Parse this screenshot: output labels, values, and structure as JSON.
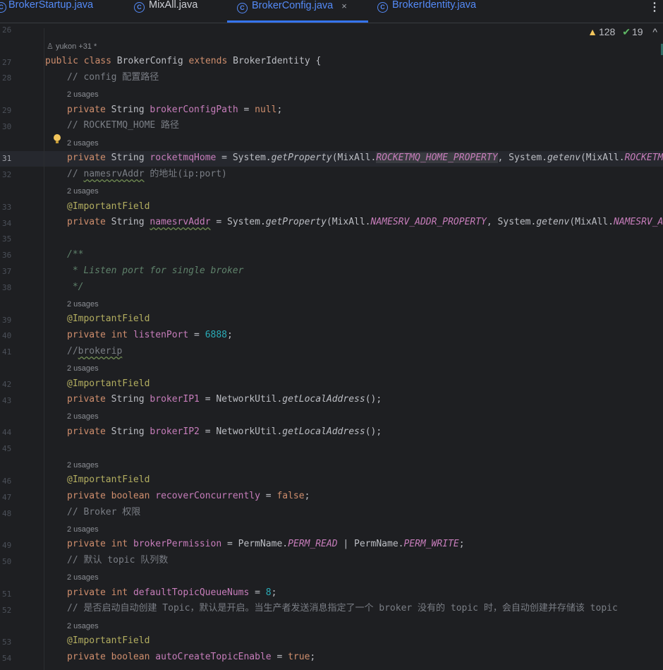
{
  "tabs": [
    {
      "label": "BrokerStartup.java"
    },
    {
      "label": "MixAll.java"
    },
    {
      "label": "BrokerConfig.java"
    },
    {
      "label": "BrokerIdentity.java"
    }
  ],
  "tab_close_glyph": "×",
  "more_glyph": "⋮",
  "inspections": {
    "warnings": "128",
    "weak_warnings": "19"
  },
  "author_hint": "yukon +31 *",
  "line_numbers": [
    "26",
    "27",
    "28",
    "29",
    "30",
    "31",
    "32",
    "33",
    "34",
    "35",
    "36",
    "37",
    "38",
    "39",
    "40",
    "41",
    "42",
    "43",
    "44",
    "45",
    "46",
    "47",
    "48",
    "49",
    "50",
    "51",
    "52",
    "53",
    "54"
  ],
  "usages_hint": "2 usages",
  "code": {
    "l27": [
      "public class ",
      "BrokerConfig ",
      "extends ",
      "BrokerIdentity {"
    ],
    "l28": "// config 配置路径",
    "l29": [
      "private ",
      "String ",
      "brokerConfigPath",
      " = ",
      "null",
      ";"
    ],
    "l30": "// ROCKETMQ_HOME 路径",
    "l31": [
      "private ",
      "String ",
      "rocketmqHome",
      " = System.",
      "getProperty",
      "(MixAll.",
      "ROCKETMQ_HOME_PROPERTY",
      ", System.",
      "getenv",
      "(MixAll.",
      "ROCKETMQ_H"
    ],
    "l32": [
      "// ",
      "namesrvAddr",
      " 的地址(ip:port)"
    ],
    "l33": "@ImportantField",
    "l34": [
      "private ",
      "String ",
      "namesrvAddr",
      " = System.",
      "getProperty",
      "(MixAll.",
      "NAMESRV_ADDR_PROPERTY",
      ", System.",
      "getenv",
      "(MixAll.",
      "NAMESRV_ADDR"
    ],
    "l36": "/**",
    "l37": " * Listen port for single broker",
    "l38": " */",
    "l39": "@ImportantField",
    "l40": [
      "private ",
      "int ",
      "listenPort",
      " = ",
      "6888",
      ";"
    ],
    "l41": [
      "//",
      "brokerip"
    ],
    "l42": "@ImportantField",
    "l43": [
      "private ",
      "String ",
      "brokerIP1",
      " = NetworkUtil.",
      "getLocalAddress",
      "();"
    ],
    "l44": [
      "private ",
      "String ",
      "brokerIP2",
      " = NetworkUtil.",
      "getLocalAddress",
      "();"
    ],
    "l46": "@ImportantField",
    "l47": [
      "private ",
      "boolean ",
      "recoverConcurrently",
      " = ",
      "false",
      ";"
    ],
    "l48": "// Broker 权限",
    "l49": [
      "private ",
      "int ",
      "brokerPermission",
      " = PermName.",
      "PERM_READ",
      " | PermName.",
      "PERM_WRITE",
      ";"
    ],
    "l50": "// 默认 topic 队列数",
    "l51": [
      "private ",
      "int ",
      "defaultTopicQueueNums",
      " = ",
      "8",
      ";"
    ],
    "l52": "// 是否启动自动创建 Topic，默认是开启。当生产者发送消息指定了一个 broker 没有的 topic 时，会自动创建并存储该 topic",
    "l53": "@ImportantField",
    "l54": [
      "private ",
      "boolean ",
      "autoCreateTopicEnable",
      " = ",
      "true",
      ";"
    ]
  },
  "colors": {
    "background": "#1e1f22",
    "keyword": "#cf8e6d",
    "field": "#c77dbb",
    "number": "#2aacb8",
    "annotation": "#b3ae60",
    "comment": "#7a7e85",
    "doc_comment": "#5f826b",
    "tab_active": "#548af7"
  }
}
